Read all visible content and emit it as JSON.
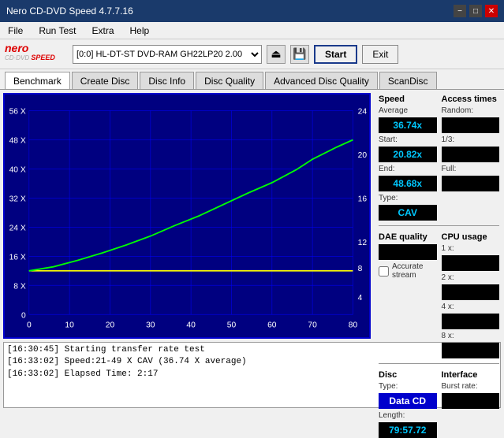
{
  "titleBar": {
    "title": "Nero CD-DVD Speed 4.7.7.16",
    "minimizeLabel": "−",
    "maximizeLabel": "□",
    "closeLabel": "✕"
  },
  "menuBar": {
    "items": [
      "File",
      "Run Test",
      "Extra",
      "Help"
    ]
  },
  "toolbar": {
    "logoNero": "nero",
    "logoCdDvd": "CD·DVD SPEED",
    "driveValue": "[0:0] HL-DT-ST DVD-RAM GH22LP20 2.00",
    "startLabel": "Start",
    "exitLabel": "Exit"
  },
  "tabs": [
    {
      "label": "Benchmark",
      "active": true
    },
    {
      "label": "Create Disc",
      "active": false
    },
    {
      "label": "Disc Info",
      "active": false
    },
    {
      "label": "Disc Quality",
      "active": false
    },
    {
      "label": "Advanced Disc Quality",
      "active": false
    },
    {
      "label": "ScanDisc",
      "active": false
    }
  ],
  "chart": {
    "yLeftLabels": [
      "56 X",
      "48 X",
      "40 X",
      "32 X",
      "24 X",
      "16 X",
      "8 X",
      "0"
    ],
    "yRightLabels": [
      "24",
      "20",
      "16",
      "12",
      "8",
      "4"
    ],
    "xLabels": [
      "0",
      "10",
      "20",
      "30",
      "40",
      "50",
      "60",
      "70",
      "80"
    ]
  },
  "rightPanel": {
    "speedSection": {
      "label": "Speed",
      "averageLabel": "Average",
      "averageValue": "36.74x",
      "startLabel": "Start:",
      "startValue": "20.82x",
      "endLabel": "End:",
      "endValue": "48.68x",
      "typeLabel": "Type:",
      "typeValue": "CAV"
    },
    "accessTimesSection": {
      "label": "Access times",
      "randomLabel": "Random:",
      "randomValue": "",
      "oneThirdLabel": "1/3:",
      "oneThirdValue": "",
      "fullLabel": "Full:",
      "fullValue": ""
    },
    "cpuSection": {
      "label": "CPU usage",
      "1xLabel": "1 x:",
      "1xValue": "",
      "2xLabel": "2 x:",
      "2xValue": "",
      "4xLabel": "4 x:",
      "4xValue": "",
      "8xLabel": "8 x:",
      "8xValue": ""
    },
    "daeSection": {
      "label": "DAE quality",
      "value": "",
      "accurateStreamLabel": "Accurate stream",
      "accurateStreamChecked": false
    },
    "discSection": {
      "typeLabel": "Disc",
      "typeSubLabel": "Type:",
      "typeValue": "Data CD",
      "lengthLabel": "Length:",
      "lengthValue": "79:57.72"
    },
    "interfaceSection": {
      "label": "Interface",
      "burstRateLabel": "Burst rate:",
      "burstValue": ""
    }
  },
  "logLines": [
    "[16:30:45]  Starting transfer rate test",
    "[16:33:02]  Speed:21-49 X CAV (36.74 X average)",
    "[16:33:02]  Elapsed Time: 2:17"
  ]
}
